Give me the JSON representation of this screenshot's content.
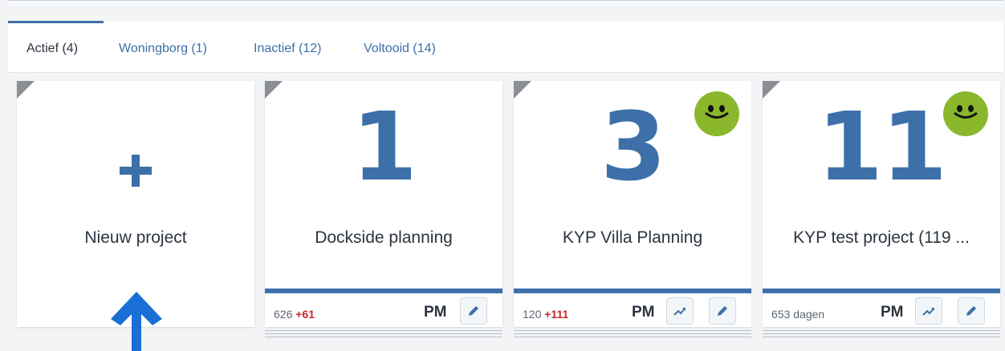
{
  "tabs": [
    {
      "label": "Actief (4)",
      "active": true
    },
    {
      "label": "Woningborg (1)",
      "active": false
    },
    {
      "label": "Inactief (12)",
      "active": false
    },
    {
      "label": "Voltooid (14)",
      "active": false
    }
  ],
  "new_project": {
    "label": "Nieuw project",
    "icon": "plus-icon"
  },
  "projects": [
    {
      "number": "1",
      "title": "Dockside planning",
      "stat": "626",
      "stat_delta": "+61",
      "pm": "PM",
      "smiley": false,
      "trend_button": false
    },
    {
      "number": "3",
      "title": "KYP Villa Planning",
      "stat": "120",
      "stat_delta": "+111",
      "pm": "PM",
      "smiley": true,
      "trend_button": true
    },
    {
      "number": "11",
      "title": "KYP test project (119 ...",
      "stat": "653 dagen",
      "stat_delta": "",
      "pm": "PM",
      "smiley": true,
      "trend_button": true
    }
  ],
  "colors": {
    "accent": "#3d70a8",
    "smiley": "#8bb72d",
    "delta_red": "#c62828",
    "arrow": "#1a6fd6"
  },
  "annotation": {
    "icon": "up-arrow-icon"
  }
}
